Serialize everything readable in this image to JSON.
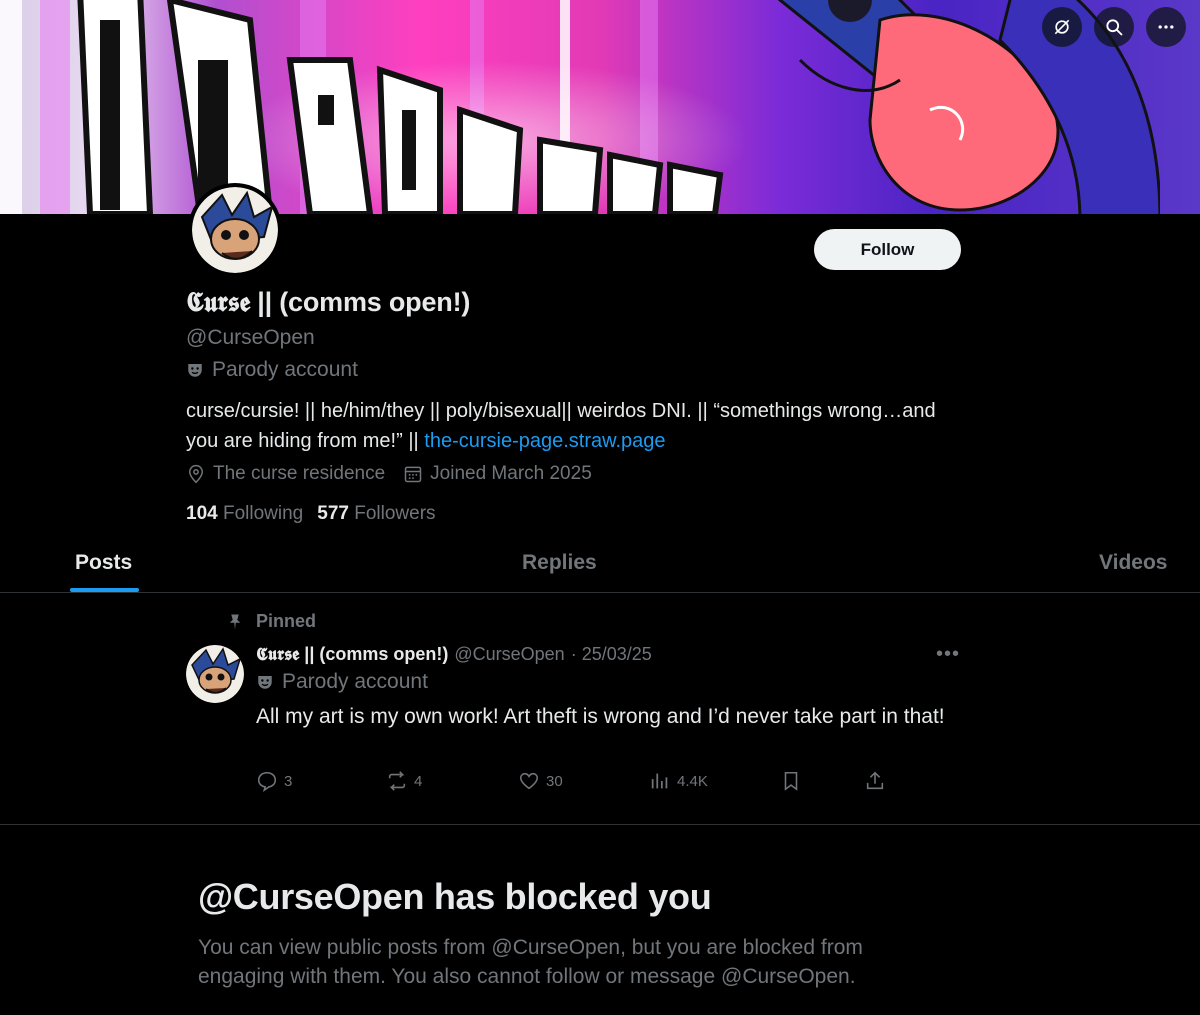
{
  "profile": {
    "display_name": "𝕮𝖚𝖗𝖘𝖊 || (comms open!)",
    "handle": "@CurseOpen",
    "label": "Parody account",
    "bio_text": "curse/cursie! || he/him/they || poly/bisexual|| weirdos DNI. || “somethings wrong…and you are hiding from me!” || ",
    "bio_link": "the-cursie-page.straw.page",
    "location": "The curse residence",
    "joined": "Joined March 2025",
    "following_count": "104",
    "following_label": "Following",
    "followers_count": "577",
    "followers_label": "Followers",
    "follow_button": "Follow"
  },
  "top_actions": {
    "icons": [
      "grok-icon",
      "search-icon",
      "more-icon"
    ]
  },
  "tabs": [
    {
      "label": "Posts",
      "active": true
    },
    {
      "label": "Replies",
      "active": false
    },
    {
      "label": "Videos",
      "active": false
    }
  ],
  "pinned_post": {
    "pinned_label": "Pinned",
    "author_name": "𝕮𝖚𝖗𝖘𝖊 || (comms open!)",
    "author_handle": "@CurseOpen",
    "date": "· 25/03/25",
    "author_label": "Parody account",
    "text": "All my art is my own work! Art theft is wrong and I’d never take part in that!",
    "replies": "3",
    "reposts": "4",
    "likes": "30",
    "views": "4.4K"
  },
  "blocked": {
    "title": "@CurseOpen has blocked you",
    "description": "You can view public posts from @CurseOpen, but you are blocked from engaging with them. You also cannot follow or message @CurseOpen."
  },
  "colors": {
    "background": "#000000",
    "accent": "#1d9bf0",
    "text_primary": "#e7e9ea",
    "text_secondary": "#71767b",
    "border": "#2f3336"
  }
}
